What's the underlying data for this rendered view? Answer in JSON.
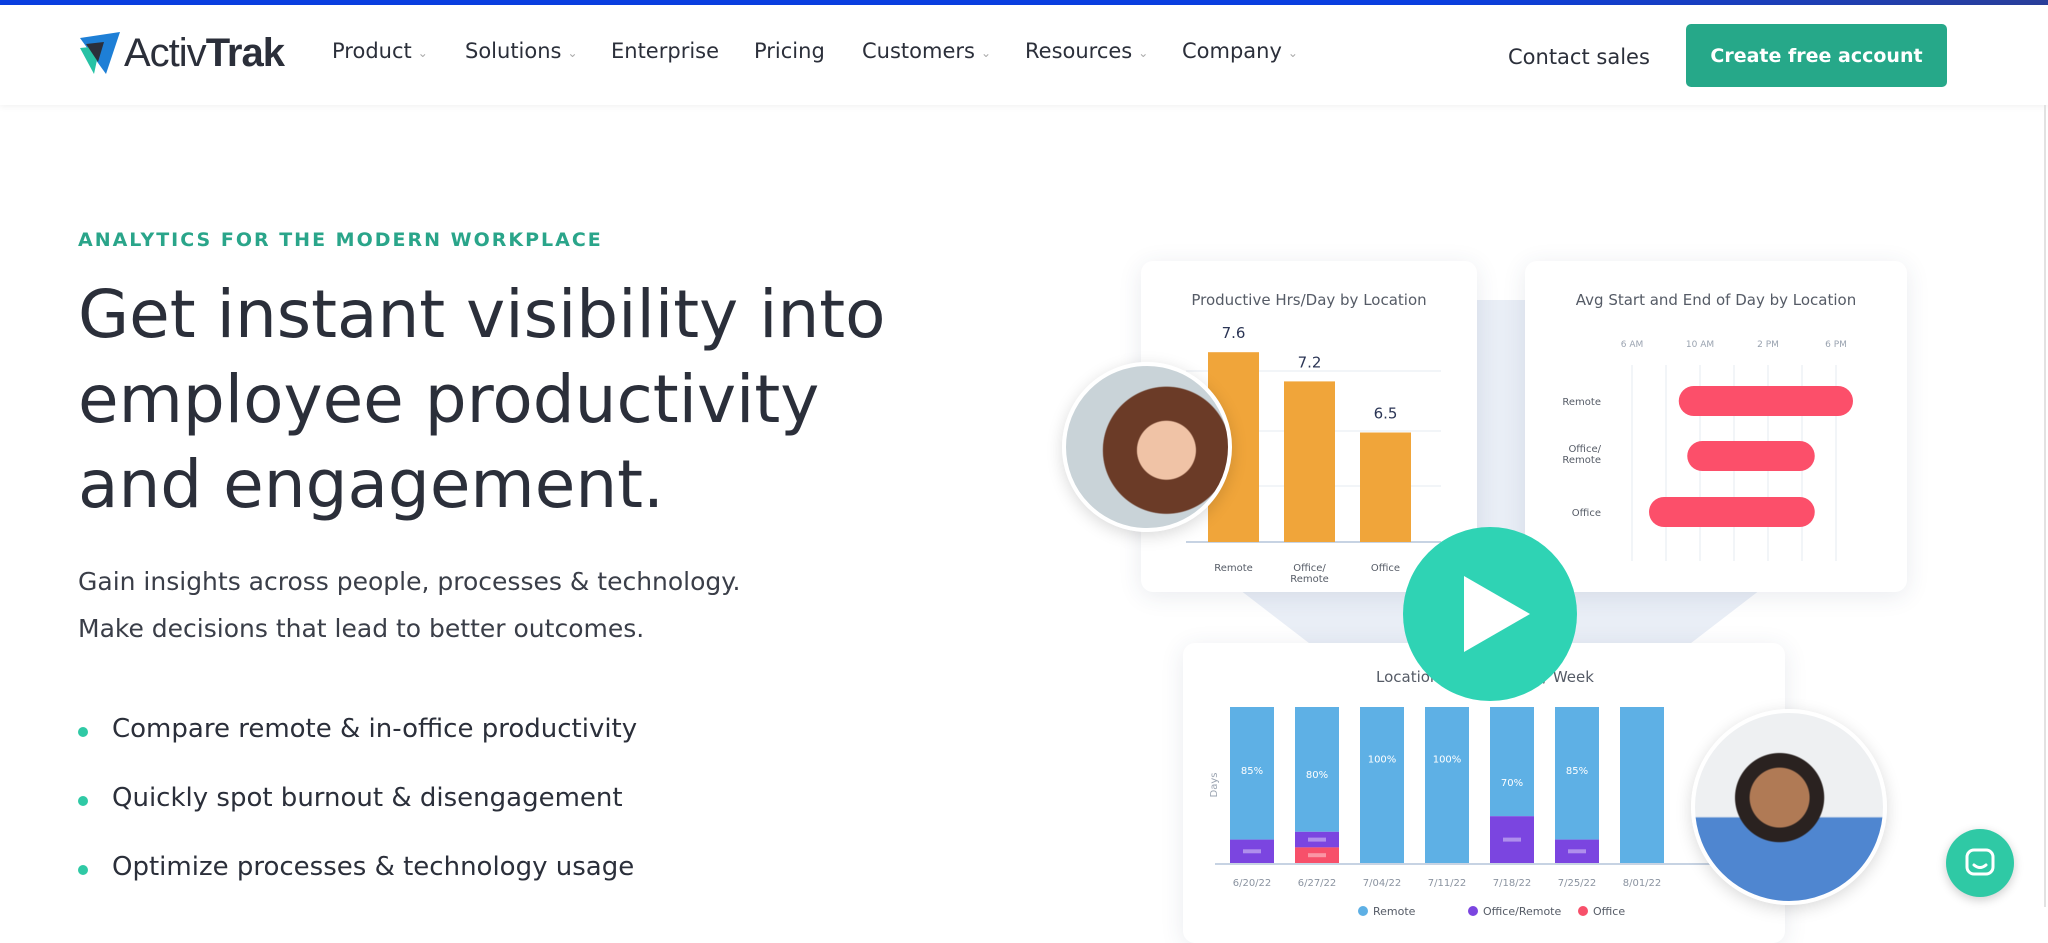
{
  "nav": {
    "logo_text_light": "Activ",
    "logo_text_bold": "Trak",
    "items": [
      {
        "label": "Product",
        "dropdown": true
      },
      {
        "label": "Solutions",
        "dropdown": true
      },
      {
        "label": "Enterprise",
        "dropdown": false
      },
      {
        "label": "Pricing",
        "dropdown": false
      },
      {
        "label": "Customers",
        "dropdown": true
      },
      {
        "label": "Resources",
        "dropdown": true
      },
      {
        "label": "Company",
        "dropdown": true
      }
    ],
    "chevron": "⌄",
    "contact": "Contact sales",
    "cta": "Create free account"
  },
  "hero": {
    "eyebrow": "ANALYTICS FOR THE MODERN WORKPLACE",
    "headline": [
      "Get instant visibility into",
      "employee productivity",
      "and engagement."
    ],
    "subtitle": [
      "Gain insights across people, processes & technology.",
      "Make decisions that lead to better outcomes."
    ],
    "bullets": [
      "Compare remote & in-office productivity",
      "Quickly spot burnout & disengagement",
      "Optimize processes & technology usage"
    ]
  },
  "colors": {
    "accent": "#26a889",
    "play": "#2fd3b4",
    "orange": "#f0a53a",
    "pink": "#fc4f6a",
    "blue": "#5eb0e5",
    "purple": "#7b45e0",
    "red": "#f7506a"
  },
  "chart_data": [
    {
      "type": "bar",
      "title": "Productive Hrs/Day by Location",
      "categories": [
        "Remote",
        "Office/\nRemote",
        "Office"
      ],
      "values": [
        7.6,
        7.2,
        6.5
      ]
    },
    {
      "type": "bar",
      "orientation": "horizontal-range",
      "title": "Avg Start and End of Day by Location",
      "x_ticks": [
        "6 AM",
        "10 AM",
        "2 PM",
        "6 PM"
      ],
      "categories": [
        "Remote",
        "Office/\nRemote",
        "Office"
      ],
      "ranges_hours": [
        [
          8.75,
          19
        ],
        [
          9.25,
          16.75
        ],
        [
          7,
          16.75
        ]
      ]
    },
    {
      "type": "bar",
      "stacked": true,
      "title_parts": [
        "Location",
        "/ Week"
      ],
      "ylabel": "Days",
      "categories": [
        "6/20/22",
        "6/27/22",
        "7/04/22",
        "7/11/22",
        "7/18/22",
        "7/25/22",
        "8/01/22"
      ],
      "series": [
        {
          "name": "Remote",
          "values": [
            85,
            80,
            100,
            100,
            70,
            85,
            100
          ]
        },
        {
          "name": "Office/Remote",
          "values": [
            15,
            10,
            0,
            0,
            30,
            15,
            0
          ]
        },
        {
          "name": "Office",
          "values": [
            0,
            10,
            0,
            0,
            0,
            0,
            0
          ]
        }
      ],
      "data_labels": [
        "85%",
        "80%",
        "100%",
        "100%",
        "70%",
        "85%",
        ""
      ],
      "legend": "bottom"
    }
  ]
}
